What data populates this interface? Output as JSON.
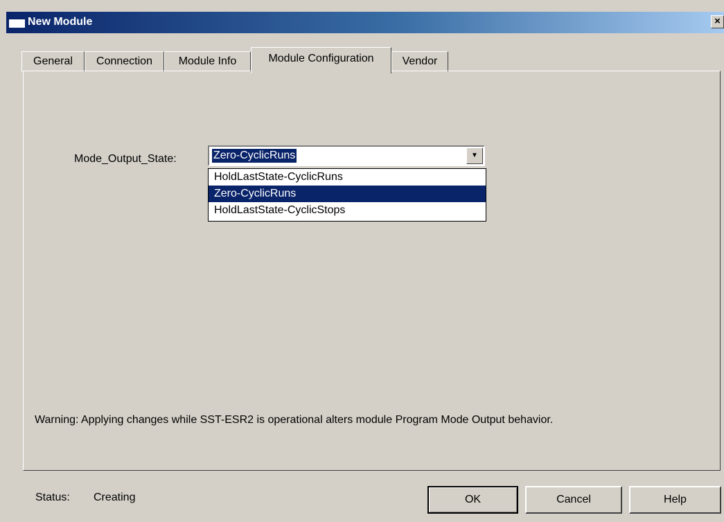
{
  "window": {
    "title": "New Module",
    "close_glyph": "×"
  },
  "tabs": [
    {
      "label": "General"
    },
    {
      "label": "Connection"
    },
    {
      "label": "Module Info"
    },
    {
      "label": "Module Configuration",
      "active": true
    },
    {
      "label": "Vendor"
    }
  ],
  "form": {
    "field_label": "Mode_Output_State:",
    "selected_value": "Zero-CyclicRuns",
    "options": [
      {
        "label": "HoldLastState-CyclicRuns"
      },
      {
        "label": "Zero-CyclicRuns",
        "selected": true
      },
      {
        "label": "HoldLastState-CyclicStops"
      }
    ]
  },
  "warning": "Warning: Applying changes while SST-ESR2 is operational alters module Program Mode Output behavior.",
  "status": {
    "label": "Status:",
    "value": "Creating"
  },
  "buttons": {
    "ok": "OK",
    "cancel": "Cancel",
    "help": "Help"
  },
  "colors": {
    "selection": "#0a246a",
    "face": "#d4d0c8"
  }
}
